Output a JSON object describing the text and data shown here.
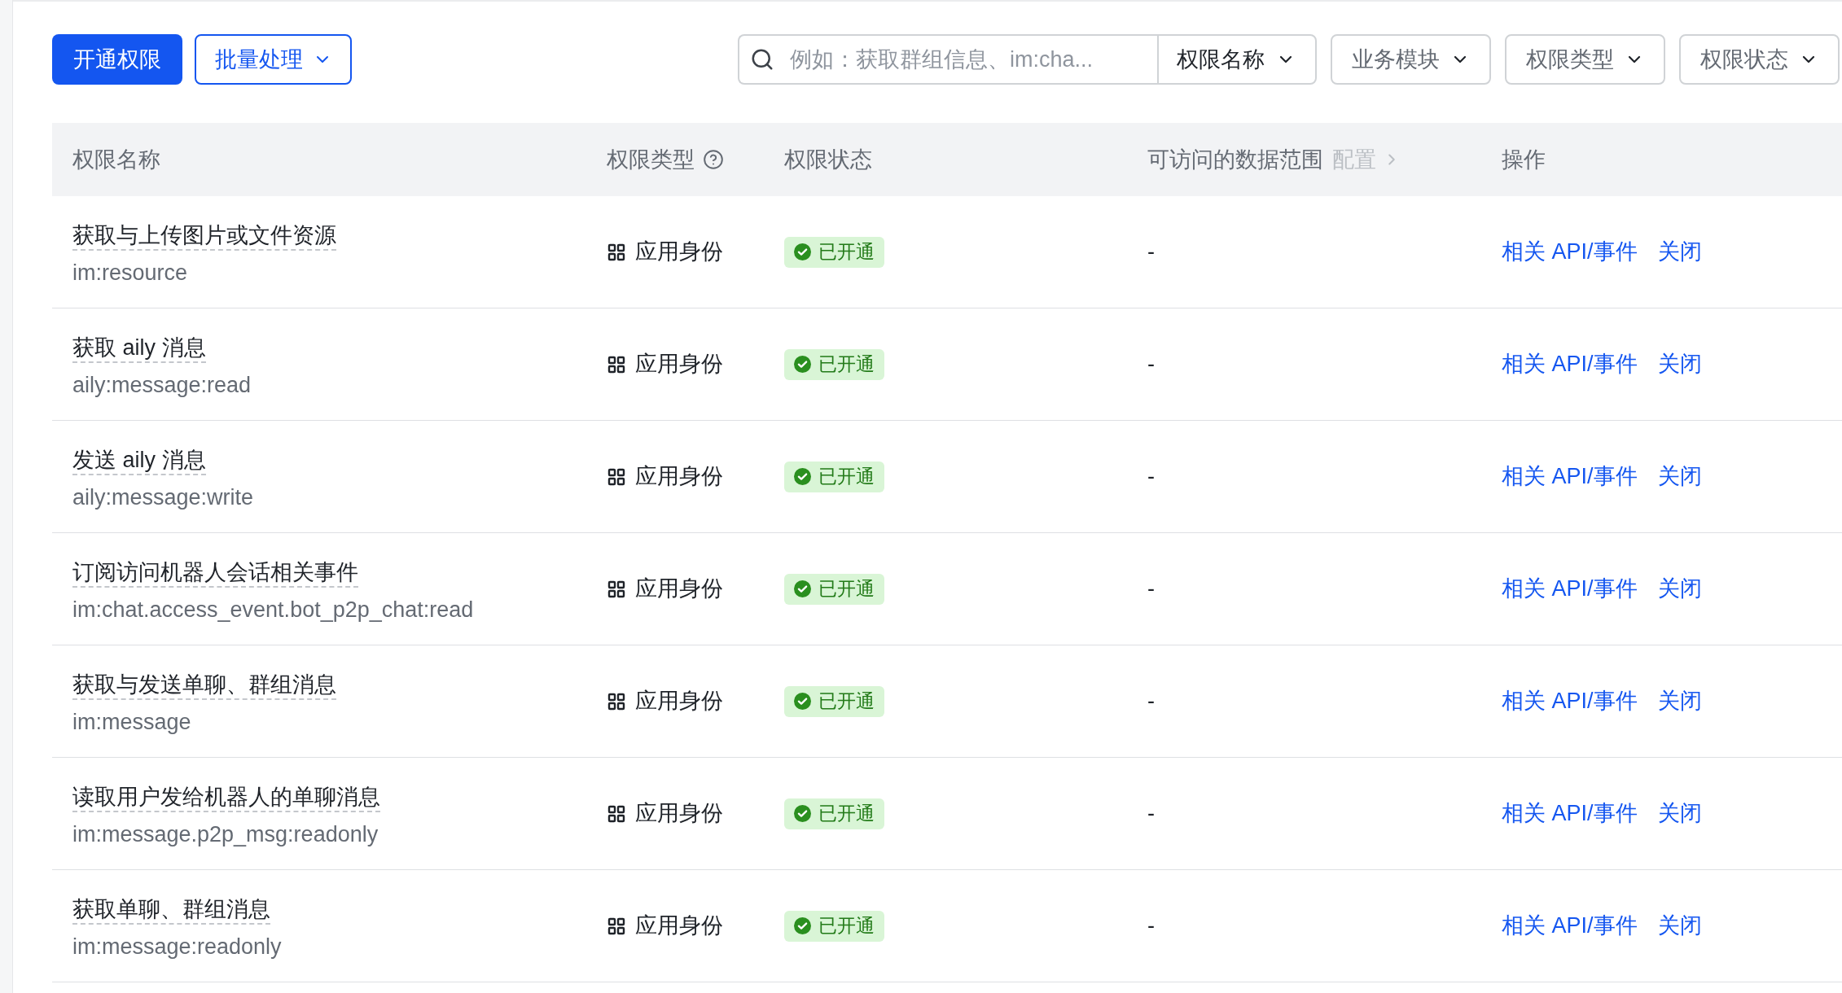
{
  "toolbar": {
    "primary_button": "开通权限",
    "batch_button": "批量处理",
    "search": {
      "placeholder": "例如：获取群组信息、im:cha...",
      "scope": "权限名称"
    },
    "filters": [
      "业务模块",
      "权限类型",
      "权限状态"
    ]
  },
  "table": {
    "columns": [
      {
        "label": "权限名称"
      },
      {
        "label": "权限类型",
        "help": true
      },
      {
        "label": "权限状态"
      },
      {
        "label": "可访问的数据范围",
        "link": "配置"
      },
      {
        "label": "操作"
      }
    ],
    "rows": [
      {
        "name": "获取与上传图片或文件资源",
        "code": "im:resource",
        "type": "应用身份",
        "status": "已开通",
        "data_scope": "-",
        "actions": [
          "相关 API/事件",
          "关闭"
        ]
      },
      {
        "name": "获取 aily 消息",
        "code": "aily:message:read",
        "type": "应用身份",
        "status": "已开通",
        "data_scope": "-",
        "actions": [
          "相关 API/事件",
          "关闭"
        ]
      },
      {
        "name": "发送 aily 消息",
        "code": "aily:message:write",
        "type": "应用身份",
        "status": "已开通",
        "data_scope": "-",
        "actions": [
          "相关 API/事件",
          "关闭"
        ]
      },
      {
        "name": "订阅访问机器人会话相关事件",
        "code": "im:chat.access_event.bot_p2p_chat:read",
        "type": "应用身份",
        "status": "已开通",
        "data_scope": "-",
        "actions": [
          "相关 API/事件",
          "关闭"
        ]
      },
      {
        "name": "获取与发送单聊、群组消息",
        "code": "im:message",
        "type": "应用身份",
        "status": "已开通",
        "data_scope": "-",
        "actions": [
          "相关 API/事件",
          "关闭"
        ]
      },
      {
        "name": "读取用户发给机器人的单聊消息",
        "code": "im:message.p2p_msg:readonly",
        "type": "应用身份",
        "status": "已开通",
        "data_scope": "-",
        "actions": [
          "相关 API/事件",
          "关闭"
        ]
      },
      {
        "name": "获取单聊、群组消息",
        "code": "im:message:readonly",
        "type": "应用身份",
        "status": "已开通",
        "data_scope": "-",
        "actions": [
          "相关 API/事件",
          "关闭"
        ]
      }
    ]
  }
}
